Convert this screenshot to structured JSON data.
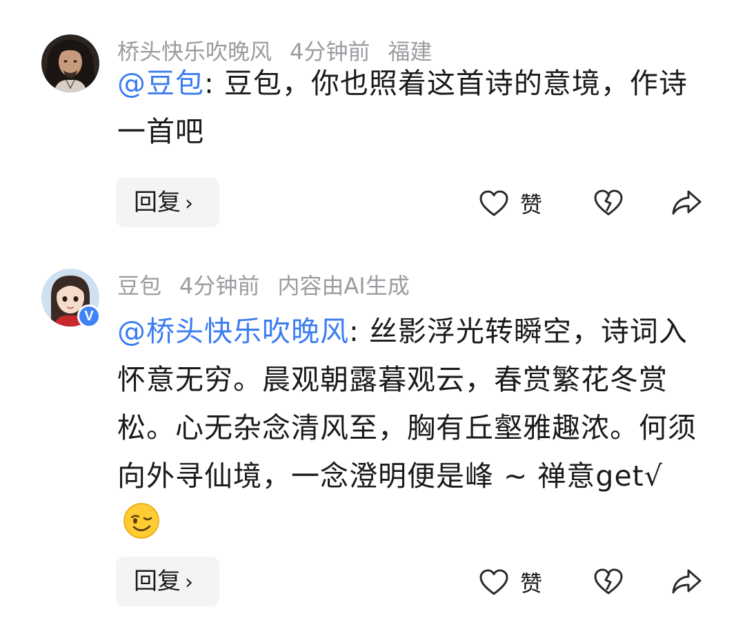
{
  "comments": [
    {
      "username": "桥头快乐吹晚风",
      "time": "4分钟前",
      "location": "福建",
      "mention": "@豆包",
      "text": ": 豆包，你也照着这首诗的意境，作诗一首吧",
      "reply_label": "回复",
      "like_label": "赞"
    },
    {
      "username": "豆包",
      "time": "4分钟前",
      "tag": "内容由AI生成",
      "mention": "@桥头快乐吹晚风",
      "text": ": 丝影浮光转瞬空，诗词入怀意无穷。晨观朝露暮观云，春赏繁花冬赏松。心无杂念清风至，胸有丘壑雅趣浓。何须向外寻仙境，一念澄明便是峰 ~ 禅意get√",
      "emoji": "winking-face",
      "verified_badge": "V",
      "reply_label": "回复",
      "like_label": "赞"
    }
  ],
  "colors": {
    "mention": "#3b7cf0",
    "meta": "#9b9ba1",
    "text": "#1a1a1a",
    "reply_bg": "#f4f4f5",
    "badge": "#3f83f8"
  }
}
